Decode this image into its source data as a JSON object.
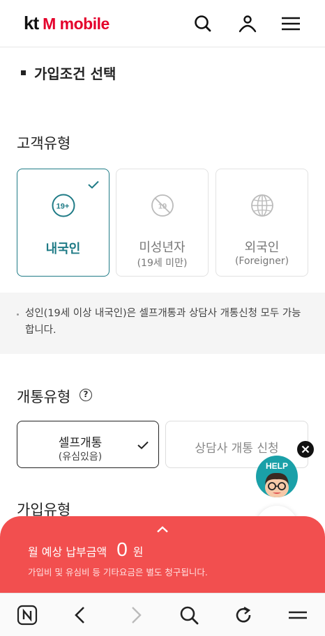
{
  "header": {
    "logo_kt": "kt",
    "logo_mobile": "M mobile",
    "brand_color": "#e4002b",
    "icons": [
      "search-icon",
      "user-icon",
      "menu-icon"
    ]
  },
  "section_title": "가입조건 선택",
  "customer_type": {
    "heading": "고객유형",
    "accent_color": "#1f7b86",
    "options": [
      {
        "label": "내국인",
        "sublabel": "",
        "icon": "age-19-plus-icon",
        "selected": true
      },
      {
        "label": "미성년자",
        "sublabel": "(19세 미만)",
        "icon": "age-19-restricted-icon",
        "selected": false
      },
      {
        "label": "외국인",
        "sublabel": "(Foreigner)",
        "icon": "globe-icon",
        "selected": false
      }
    ],
    "info_text": "성인(19세 이상 내국인)은 셀프개통과 상담사 개통신청 모두 가능합니다."
  },
  "open_type": {
    "heading": "개통유형",
    "help_icon": "?",
    "options": [
      {
        "label": "셀프개통",
        "sublabel": "(유심있음)",
        "selected": true
      },
      {
        "label": "상담사 개통 신청",
        "sublabel": "",
        "selected": false
      }
    ]
  },
  "join_type_heading": "가입유형",
  "floating": {
    "help_label": "HELP",
    "help_color": "#1aa0a8"
  },
  "bottom_sheet": {
    "label": "월 예상 납부금액",
    "amount": "0",
    "unit": "원",
    "note": "가입비 및 유심비 등 기타요금은 별도 청구됩니다.",
    "color": "#f24f4f"
  },
  "browser_bar": {
    "buttons": [
      "naver-home-icon",
      "back-icon",
      "forward-icon",
      "search-icon",
      "reload-icon",
      "tabs-menu-icon"
    ]
  }
}
